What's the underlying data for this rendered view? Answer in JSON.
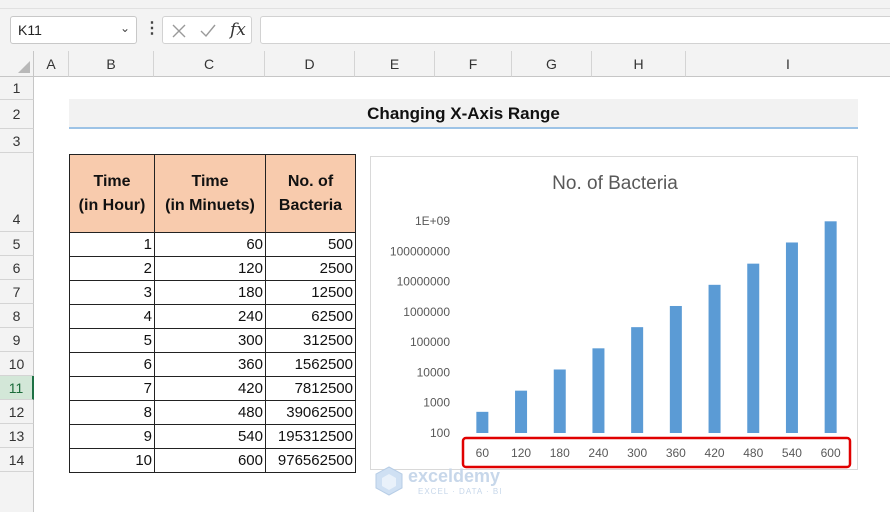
{
  "formula_bar": {
    "name_box": "K11",
    "fx_label": "fx",
    "formula": ""
  },
  "columns": [
    "A",
    "B",
    "C",
    "D",
    "E",
    "F",
    "G",
    "H",
    "I"
  ],
  "rows": [
    "1",
    "2",
    "3",
    "4",
    "5",
    "6",
    "7",
    "8",
    "9",
    "10",
    "11",
    "12",
    "13",
    "14"
  ],
  "selected_row": "11",
  "sheet_title": "Changing X-Axis Range",
  "table": {
    "headers": [
      [
        "Time",
        "(in Hour)"
      ],
      [
        "Time",
        "(in Minuets)"
      ],
      [
        "No. of",
        "Bacteria"
      ]
    ],
    "rows": [
      [
        "1",
        "60",
        "500"
      ],
      [
        "2",
        "120",
        "2500"
      ],
      [
        "3",
        "180",
        "12500"
      ],
      [
        "4",
        "240",
        "62500"
      ],
      [
        "5",
        "300",
        "312500"
      ],
      [
        "6",
        "360",
        "1562500"
      ],
      [
        "7",
        "420",
        "7812500"
      ],
      [
        "8",
        "480",
        "39062500"
      ],
      [
        "9",
        "540",
        "195312500"
      ],
      [
        "10",
        "600",
        "976562500"
      ]
    ]
  },
  "chart_data": {
    "type": "bar",
    "title": "No. of Bacteria",
    "categories": [
      "60",
      "120",
      "180",
      "240",
      "300",
      "360",
      "420",
      "480",
      "540",
      "600"
    ],
    "values": [
      500,
      2500,
      12500,
      62500,
      312500,
      1562500,
      7812500,
      39062500,
      195312500,
      976562500
    ],
    "y_scale": "log",
    "ylim": [
      100,
      1000000000
    ],
    "y_ticks": [
      "100",
      "1000",
      "10000",
      "100000",
      "1000000",
      "10000000",
      "100000000",
      "1E+09"
    ],
    "xlabel": "",
    "ylabel": "",
    "bar_color": "#5b9bd5",
    "highlight_color": "#e00000",
    "legend": "none"
  },
  "watermark": {
    "name": "exceldemy",
    "tagline": "EXCEL · DATA · BI"
  },
  "colors": {
    "header_fill": "#f8cbad",
    "title_underline": "#9dc3e6",
    "selected_row_header": "#d3e7d8"
  }
}
